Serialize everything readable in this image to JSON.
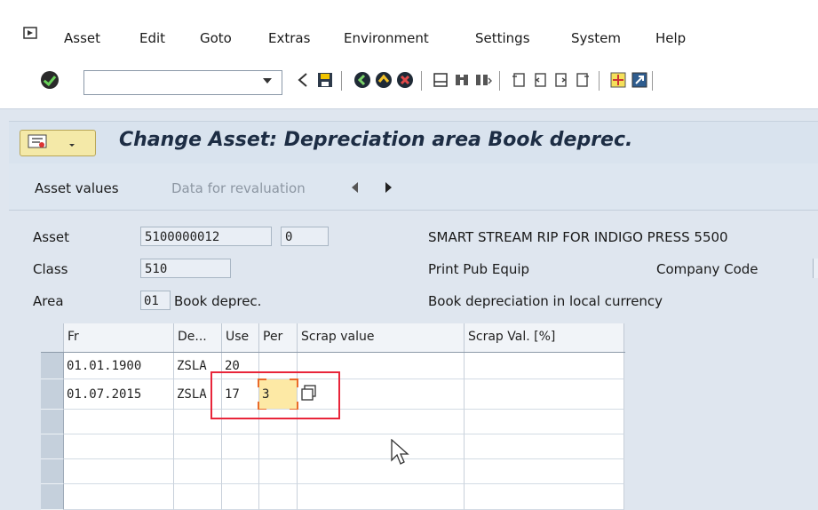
{
  "menu": {
    "items": [
      "Asset",
      "Edit",
      "Goto",
      "Extras",
      "Environment",
      "Settings",
      "System",
      "Help"
    ]
  },
  "toolbar": {
    "command_value": "",
    "icons": [
      "enter-icon",
      "back-icon",
      "save-icon",
      "back-green-icon",
      "exit-icon",
      "cancel-icon",
      "print-icon",
      "find-icon",
      "find-next-icon",
      "first-page-icon",
      "prev-page-icon",
      "next-page-icon",
      "last-page-icon",
      "create-session-icon",
      "shortcut-icon"
    ]
  },
  "title": {
    "text": "Change Asset: Depreciation area Book deprec."
  },
  "app_toolbar": {
    "asset_values": "Asset values",
    "data_for_revaluation": "Data for revaluation"
  },
  "header": {
    "asset_label": "Asset",
    "asset_number": "5100000012",
    "asset_sub": "0",
    "asset_description": "SMART STREAM RIP FOR INDIGO PRESS 5500",
    "class_label": "Class",
    "class_value": "510",
    "class_description": "Print Pub Equip",
    "company_code_label": "Company Code",
    "area_label": "Area",
    "area_number": "01",
    "area_name": "Book deprec.",
    "area_description": "Book depreciation in local currency"
  },
  "grid": {
    "columns": [
      "Fr",
      "De...",
      "Use",
      "Per",
      "Scrap value",
      "Scrap Val. [%]"
    ],
    "rows": [
      {
        "from": "01.01.1900",
        "dep_key": "ZSLA",
        "use": "20",
        "per": "",
        "scrap_value": "",
        "scrap_pct": ""
      },
      {
        "from": "01.07.2015",
        "dep_key": "ZSLA",
        "use": "17",
        "per": "3",
        "scrap_value": "",
        "scrap_pct": ""
      }
    ]
  },
  "colors": {
    "highlight": "#e8253a",
    "active_input": "#fde9a5"
  }
}
